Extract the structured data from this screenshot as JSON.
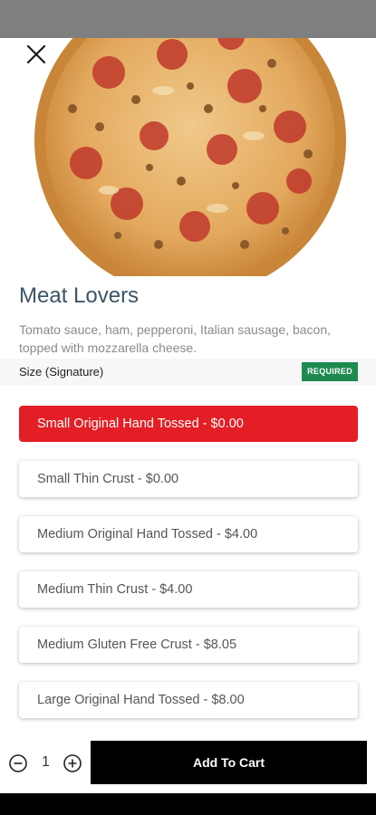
{
  "product": {
    "name": "Meat Lovers",
    "description": "Tomato sauce, ham, pepperoni, Italian sausage, bacon, topped with mozzarella cheese."
  },
  "size_section": {
    "label": "Size (Signature)",
    "badge": "REQUIRED"
  },
  "options": [
    {
      "label": "Small Original Hand Tossed - $0.00",
      "selected": true
    },
    {
      "label": "Small Thin Crust - $0.00",
      "selected": false
    },
    {
      "label": "Medium Original Hand Tossed - $4.00",
      "selected": false
    },
    {
      "label": "Medium Thin Crust - $4.00",
      "selected": false
    },
    {
      "label": "Medium Gluten Free Crust - $8.05",
      "selected": false
    },
    {
      "label": "Large Original Hand Tossed - $8.00",
      "selected": false
    }
  ],
  "footer": {
    "quantity": "1",
    "add_to_cart_label": "Add To Cart"
  },
  "colors": {
    "accent_red": "#e31e25",
    "badge_green": "#1e8a4f",
    "title_slate": "#3d5566"
  },
  "icons": [
    "close-icon",
    "minus-circle-icon",
    "plus-circle-icon"
  ]
}
